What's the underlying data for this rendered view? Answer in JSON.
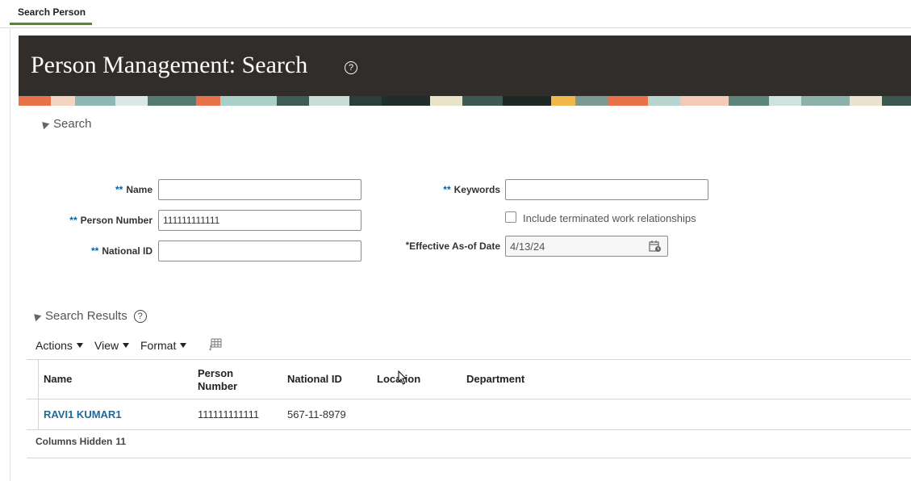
{
  "tabs": [
    {
      "label": "Search Person"
    }
  ],
  "header": {
    "title": "Person Management: Search"
  },
  "search_section": {
    "label": "Search",
    "required_marker": "**",
    "fields": {
      "name": {
        "label": "Name",
        "value": ""
      },
      "person_number": {
        "label": "Person Number",
        "value": "111111111111"
      },
      "national_id": {
        "label": "National ID",
        "value": ""
      },
      "keywords": {
        "label": "Keywords",
        "value": ""
      },
      "include_terminated": {
        "label": "Include terminated work relationships",
        "checked": false
      },
      "effective_date": {
        "required_marker": "*",
        "label": "Effective As-of Date",
        "value": "4/13/24"
      }
    }
  },
  "results_section": {
    "label": "Search Results",
    "toolbar": {
      "actions": "Actions",
      "view": "View",
      "format": "Format"
    },
    "columns": {
      "name": "Name",
      "person_number_line1": "Person",
      "person_number_line2": "Number",
      "national_id": "National ID",
      "location": "Location",
      "department": "Department"
    },
    "rows": [
      {
        "name": "RAVI1 KUMAR1",
        "person_number": "111111111111",
        "national_id": "567-11-8979",
        "location": "",
        "department": ""
      }
    ],
    "footer": {
      "label": "Columns Hidden",
      "count": "11"
    }
  },
  "colors": {
    "header_bg": "#312d2a",
    "link": "#1b6a9e",
    "tab_underline": "#5b7f45",
    "required": "#0a5e9c"
  }
}
